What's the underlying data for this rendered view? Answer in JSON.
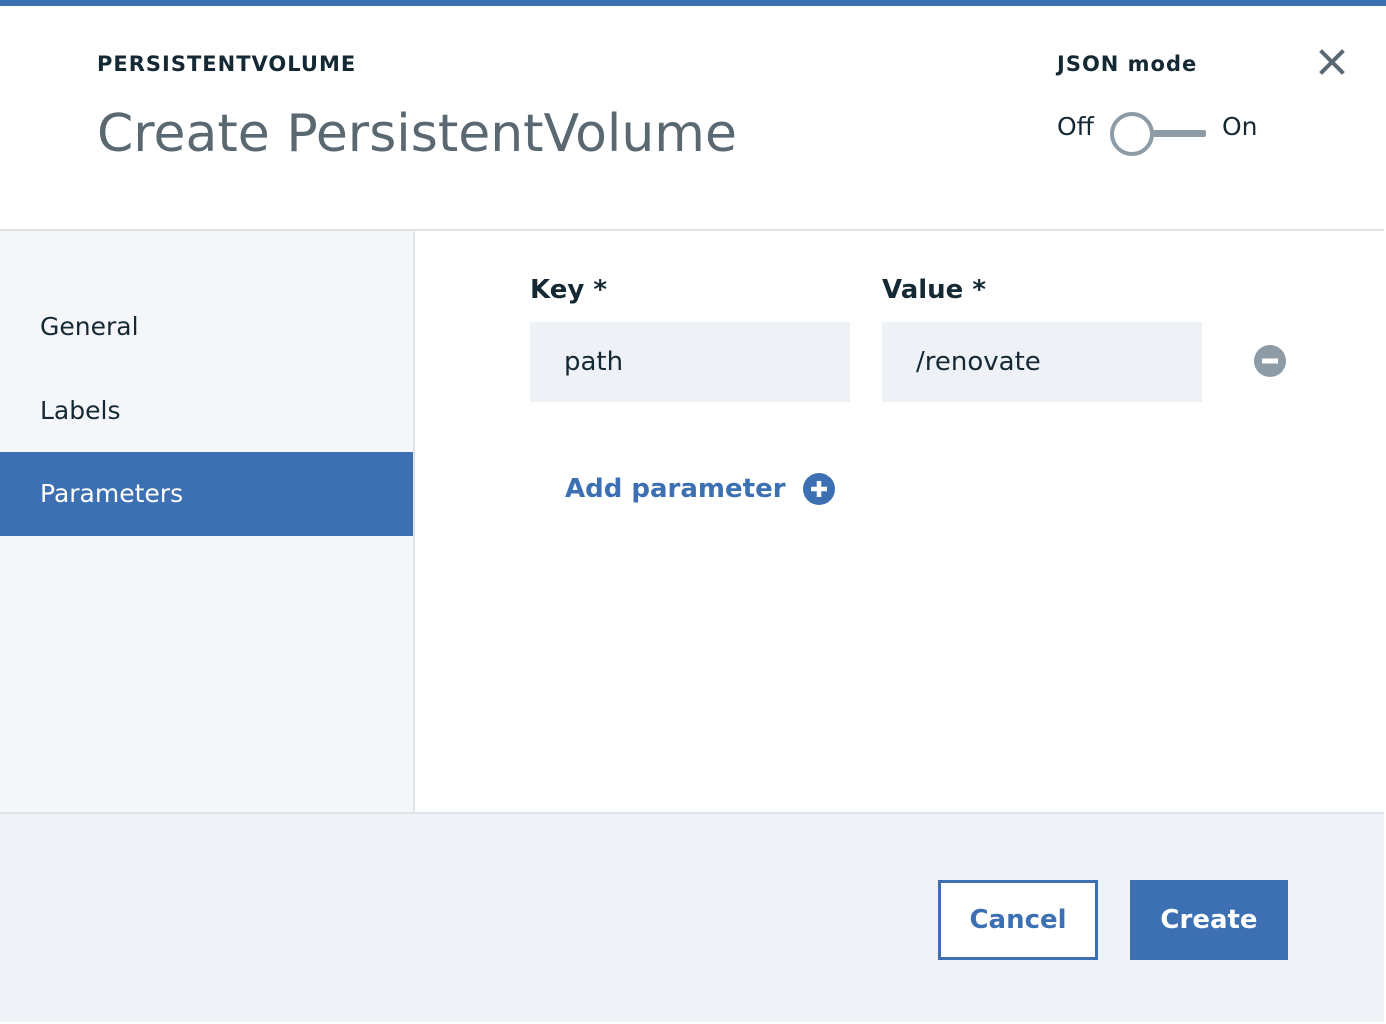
{
  "header": {
    "eyebrow": "PERSISTENTVOLUME",
    "title": "Create PersistentVolume",
    "json_mode": {
      "label": "JSON mode",
      "off_label": "Off",
      "on_label": "On",
      "state": "off"
    },
    "close_icon": "close-icon"
  },
  "sidebar": {
    "items": [
      {
        "label": "General",
        "active": false
      },
      {
        "label": "Labels",
        "active": false
      },
      {
        "label": "Parameters",
        "active": true
      }
    ]
  },
  "parameters": {
    "key_label": "Key *",
    "value_label": "Value *",
    "rows": [
      {
        "key": "path",
        "value": "/renovate"
      }
    ],
    "remove_icon": "minus-circle-icon",
    "add_label": "Add parameter",
    "add_icon": "plus-circle-icon"
  },
  "footer": {
    "cancel_label": "Cancel",
    "create_label": "Create"
  },
  "colors": {
    "accent": "#3d70b2",
    "sidebar_bg": "#f4f6fa",
    "input_bg": "#eef2f7",
    "footer_bg": "#eff2f6",
    "muted_icon": "#8c9ba5"
  }
}
